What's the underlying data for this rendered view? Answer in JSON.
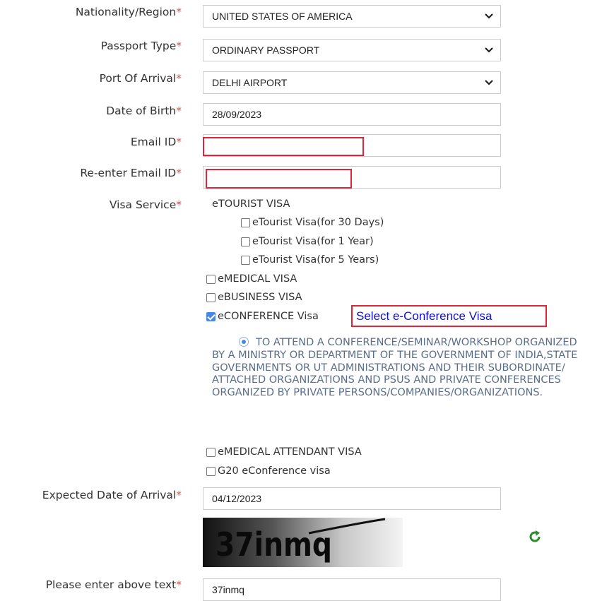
{
  "form": {
    "nationality": {
      "label": "Nationality/Region",
      "value": "UNITED STATES OF AMERICA"
    },
    "passport_type": {
      "label": "Passport Type",
      "value": "ORDINARY PASSPORT"
    },
    "port_of_arrival": {
      "label": "Port Of Arrival",
      "value": "DELHI AIRPORT"
    },
    "dob": {
      "label": "Date of Birth",
      "value": "28/09/2023"
    },
    "email": {
      "label": "Email ID",
      "value": ""
    },
    "email_confirm": {
      "label": "Re-enter Email ID",
      "value": ""
    },
    "visa_service": {
      "label": "Visa Service",
      "etourist_heading": "eTOURIST VISA",
      "etourist_options": [
        {
          "label": "eTourist Visa(for 30 Days)",
          "checked": false
        },
        {
          "label": "eTourist Visa(for 1 Year)",
          "checked": false
        },
        {
          "label": "eTourist Visa(for 5 Years)",
          "checked": false
        }
      ],
      "emedical": {
        "label": "eMEDICAL VISA",
        "checked": false
      },
      "ebusiness": {
        "label": "eBUSINESS VISA",
        "checked": false
      },
      "econference": {
        "label": "eCONFERENCE Visa",
        "checked": true
      },
      "econference_purpose": "TO ATTEND A CONFERENCE/SEMINAR/WORKSHOP ORGANIZED BY A MINISTRY OR DEPARTMENT OF THE GOVERNMENT OF INDIA,STATE GOVERNMENTS OR UT ADMINISTRATIONS AND THEIR SUBORDINATE/ ATTACHED ORGANIZATIONS AND PSUS AND PRIVATE CONFERENCES ORGANIZED BY PRIVATE PERSONS/COMPANIES/ORGANIZATIONS.",
      "emedical_attendant": {
        "label": "eMEDICAL ATTENDANT VISA",
        "checked": false
      },
      "g20": {
        "label": "G20 eConference visa",
        "checked": false
      }
    },
    "arrival_date": {
      "label": "Expected Date of Arrival",
      "value": "04/12/2023"
    },
    "captcha": {
      "text": "37inmq",
      "label": "Please enter above text",
      "value": "37inmq"
    },
    "required_mark": "*"
  },
  "annotation": {
    "callout": "Select e-Conference Visa"
  },
  "colors": {
    "highlight": "#e0253a",
    "callout_text": "#1010d0",
    "checkbox_on": "#4a86e8",
    "refresh": "#2e8b2e"
  },
  "icons": {
    "dropdown": "chevron-down-icon",
    "refresh": "refresh-icon"
  }
}
